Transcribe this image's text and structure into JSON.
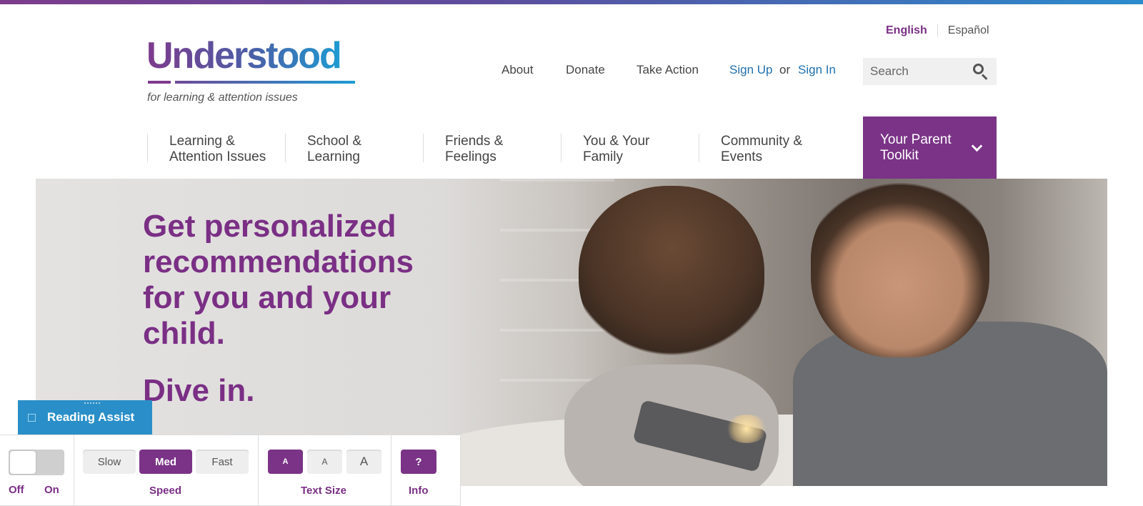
{
  "brand": {
    "logo_text": "Understood",
    "tagline": "for learning & attention issues"
  },
  "language": {
    "active": "English",
    "alternate": "Español"
  },
  "utility_nav": {
    "about": "About",
    "donate": "Donate",
    "take_action": "Take Action",
    "sign_up": "Sign Up",
    "or": "or",
    "sign_in": "Sign In"
  },
  "search": {
    "placeholder": "Search",
    "icon": "search-icon"
  },
  "main_nav": {
    "items": [
      {
        "line1": "Learning &",
        "line2": "Attention Issues"
      },
      {
        "line1": "School &",
        "line2": "Learning"
      },
      {
        "line1": "Friends &",
        "line2": "Feelings"
      },
      {
        "line1": "You & Your",
        "line2": "Family"
      },
      {
        "line1": "Community &",
        "line2": "Events"
      }
    ],
    "toolkit": {
      "line1": "Your Parent",
      "line2": "Toolkit",
      "icon": "chevron-down-icon"
    }
  },
  "hero": {
    "title": "Get personalized recommendations for you and your child.",
    "subtitle": "Dive in."
  },
  "reading_assist": {
    "label": "Reading Assist",
    "toggle": {
      "off": "Off",
      "on": "On",
      "state": "off"
    },
    "speed": {
      "label": "Speed",
      "options": [
        "Slow",
        "Med",
        "Fast"
      ],
      "selected": "Med"
    },
    "text_size": {
      "label": "Text Size",
      "options": [
        "A",
        "A",
        "A"
      ],
      "selected_index": 0
    },
    "info": {
      "label": "Info",
      "button": "?"
    }
  },
  "colors": {
    "brand_purple": "#7a3386",
    "link_blue": "#1f6fae",
    "assist_blue": "#2a8fc8"
  }
}
